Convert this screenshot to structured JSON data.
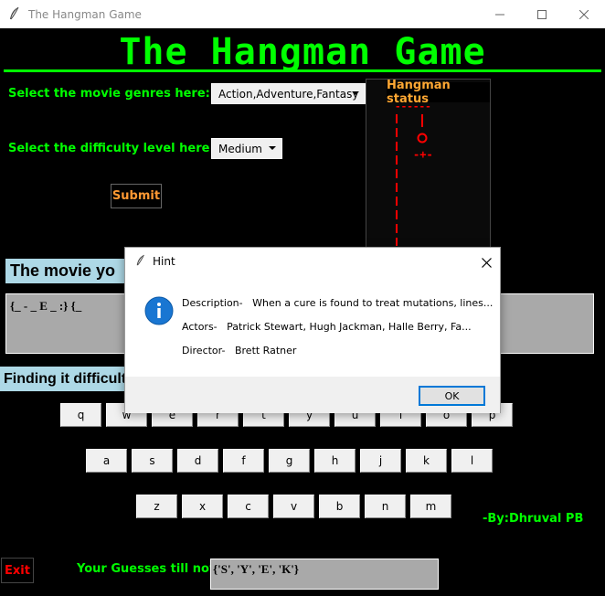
{
  "window": {
    "title": "The Hangman Game",
    "minimize_icon": "minimize-icon",
    "maximize_icon": "maximize-icon",
    "close_icon": "close-icon"
  },
  "header": {
    "title": "The Hangman Game",
    "accent_color": "#00ff00"
  },
  "genre": {
    "label": "Select the movie genres here:",
    "value": "Action,Adventure,Fantasy"
  },
  "difficulty": {
    "label": "Select the difficulty level here:",
    "value": "Medium"
  },
  "submit_label": "Submit",
  "status": {
    "title": "Hangman status",
    "figure_color": "#ff0000",
    "lines": [
      "------",
      "|",
      "o",
      "-+-"
    ]
  },
  "movie": {
    "label": "The movie yo",
    "word": "{_ - _ E _ :} {_"
  },
  "hint_prompt": "Finding it difficult",
  "keyboard": {
    "row1": [
      "q",
      "w",
      "e",
      "r",
      "t",
      "y",
      "u",
      "i",
      "o",
      "p"
    ],
    "row2": [
      "a",
      "s",
      "d",
      "f",
      "g",
      "h",
      "j",
      "k",
      "l"
    ],
    "row3": [
      "z",
      "x",
      "c",
      "v",
      "b",
      "n",
      "m"
    ]
  },
  "credit": "-By:Dhruval PB",
  "exit_label": "Exit",
  "guesses": {
    "label": "Your Guesses till now:",
    "value": "{'S', 'Y', 'E', 'K'}"
  },
  "dialog": {
    "title": "Hint",
    "description_label": "Description-",
    "description_value": "When a cure is found to treat mutations, lines...",
    "actors_label": "Actors-",
    "actors_value": "Patrick Stewart, Hugh Jackman, Halle Berry, Fa...",
    "director_label": "Director-",
    "director_value": "Brett Ratner",
    "ok_label": "OK",
    "info_icon": "info-icon",
    "accent_color": "#0078d7"
  }
}
